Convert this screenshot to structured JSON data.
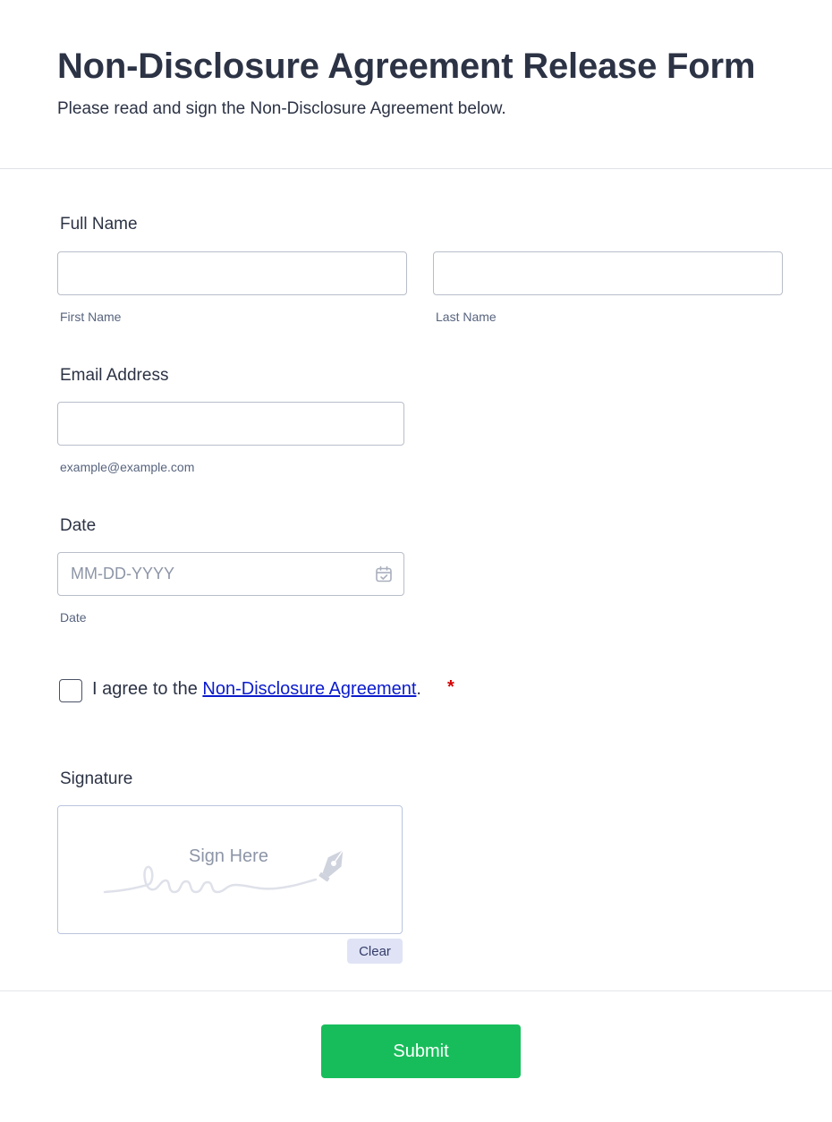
{
  "header": {
    "title": "Non-Disclosure Agreement Release Form",
    "subtitle": "Please read and sign the Non-Disclosure Agreement below."
  },
  "full_name": {
    "label": "Full Name",
    "first": {
      "sublabel": "First Name",
      "value": "",
      "placeholder": ""
    },
    "last": {
      "sublabel": "Last Name",
      "value": "",
      "placeholder": ""
    }
  },
  "email": {
    "label": "Email Address",
    "sublabel": "example@example.com",
    "value": "",
    "placeholder": ""
  },
  "date": {
    "label": "Date",
    "sublabel": "Date",
    "value": "",
    "placeholder": "MM-DD-YYYY",
    "icon": "calendar-icon"
  },
  "agreement": {
    "prefix": "I agree to the ",
    "link_text": "Non-Disclosure Agreement",
    "suffix": ".",
    "required_marker": "*",
    "checked": false
  },
  "signature": {
    "label": "Signature",
    "hint": "Sign Here",
    "icon": "pen-nib-icon",
    "clear_label": "Clear"
  },
  "submit": {
    "label": "Submit"
  },
  "colors": {
    "text": "#2c3345",
    "submit_bg": "#18bd5b",
    "link": "#0b1bcc",
    "required": "#d60000",
    "clear_bg": "#dfe3f5"
  }
}
